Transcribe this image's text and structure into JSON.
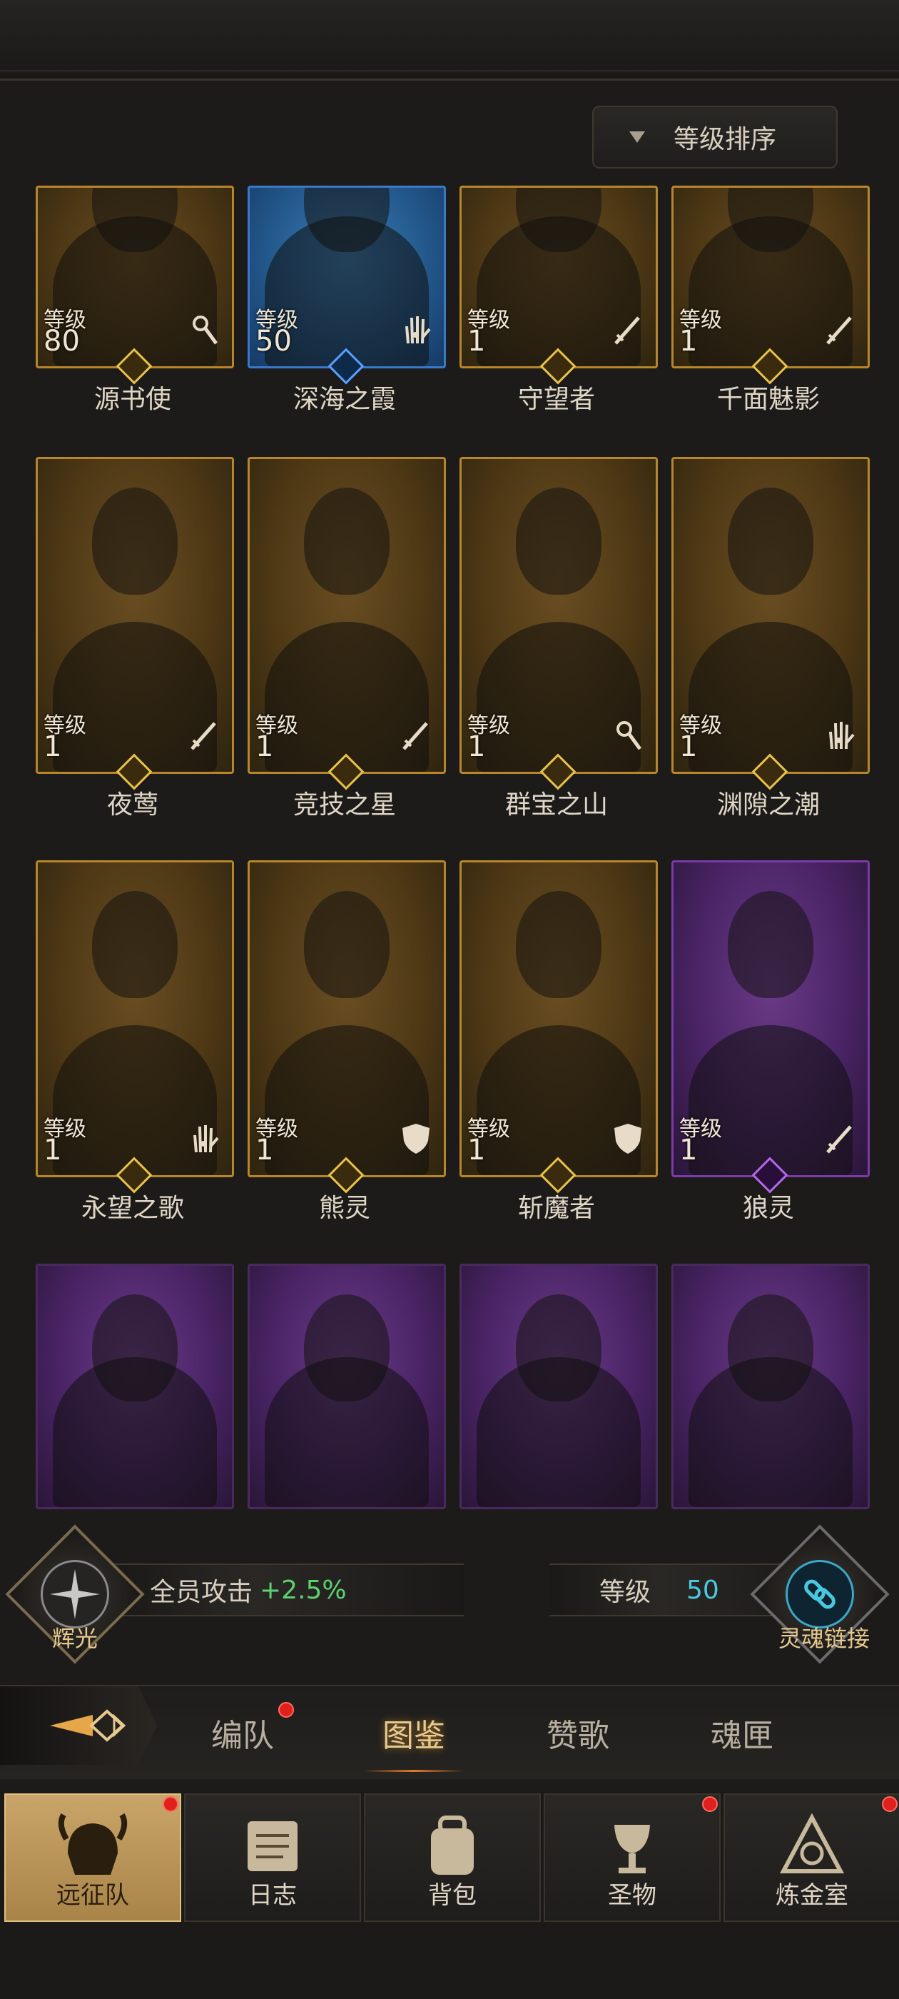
{
  "sort": {
    "label": "等级排序"
  },
  "level_label": "等级",
  "heroes": [
    {
      "name": "源书使",
      "level": "80",
      "rarity": "gold",
      "cls": "staff-icon"
    },
    {
      "name": "深海之霞",
      "level": "50",
      "rarity": "blue",
      "cls": "palm-icon"
    },
    {
      "name": "守望者",
      "level": "1",
      "rarity": "gold",
      "cls": "sword-icon"
    },
    {
      "name": "千面魅影",
      "level": "1",
      "rarity": "gold",
      "cls": "sword-icon"
    },
    {
      "name": "夜莺",
      "level": "1",
      "rarity": "gold",
      "cls": "sword-icon"
    },
    {
      "name": "竞技之星",
      "level": "1",
      "rarity": "gold",
      "cls": "sword-icon"
    },
    {
      "name": "群宝之山",
      "level": "1",
      "rarity": "gold",
      "cls": "staff-icon"
    },
    {
      "name": "渊隙之潮",
      "level": "1",
      "rarity": "gold",
      "cls": "palm-icon"
    },
    {
      "name": "永望之歌",
      "level": "1",
      "rarity": "gold",
      "cls": "palm-icon"
    },
    {
      "name": "熊灵",
      "level": "1",
      "rarity": "gold",
      "cls": "shield-icon"
    },
    {
      "name": "斩魔者",
      "level": "1",
      "rarity": "gold",
      "cls": "shield-icon"
    },
    {
      "name": "狼灵",
      "level": "1",
      "rarity": "purple",
      "cls": "sword-icon"
    }
  ],
  "bottom_row_rarity": "purple",
  "bonus": {
    "left_emblem_label": "辉光",
    "attack_text": "全员攻击",
    "attack_value": "+2.5%",
    "level_text": "等级",
    "level_value": "50",
    "right_emblem_label": "灵魂链接"
  },
  "tabs": [
    {
      "label": "编队",
      "badge": true
    },
    {
      "label": "图鉴",
      "active": true
    },
    {
      "label": "赞歌"
    },
    {
      "label": "魂匣"
    }
  ],
  "nav": [
    {
      "label": "远征队",
      "active": true,
      "badge": true,
      "icon": "helmet-icon"
    },
    {
      "label": "日志",
      "icon": "scroll-icon"
    },
    {
      "label": "背包",
      "icon": "backpack-icon"
    },
    {
      "label": "圣物",
      "badge": true,
      "icon": "chalice-icon"
    },
    {
      "label": "炼金室",
      "badge": true,
      "icon": "alchemy-icon"
    }
  ],
  "colors": {
    "gold": "#b8862a",
    "blue": "#3a78c8",
    "purple": "#7a3aa8",
    "accent_green": "#5fd070",
    "accent_cyan": "#4ac8e0"
  }
}
